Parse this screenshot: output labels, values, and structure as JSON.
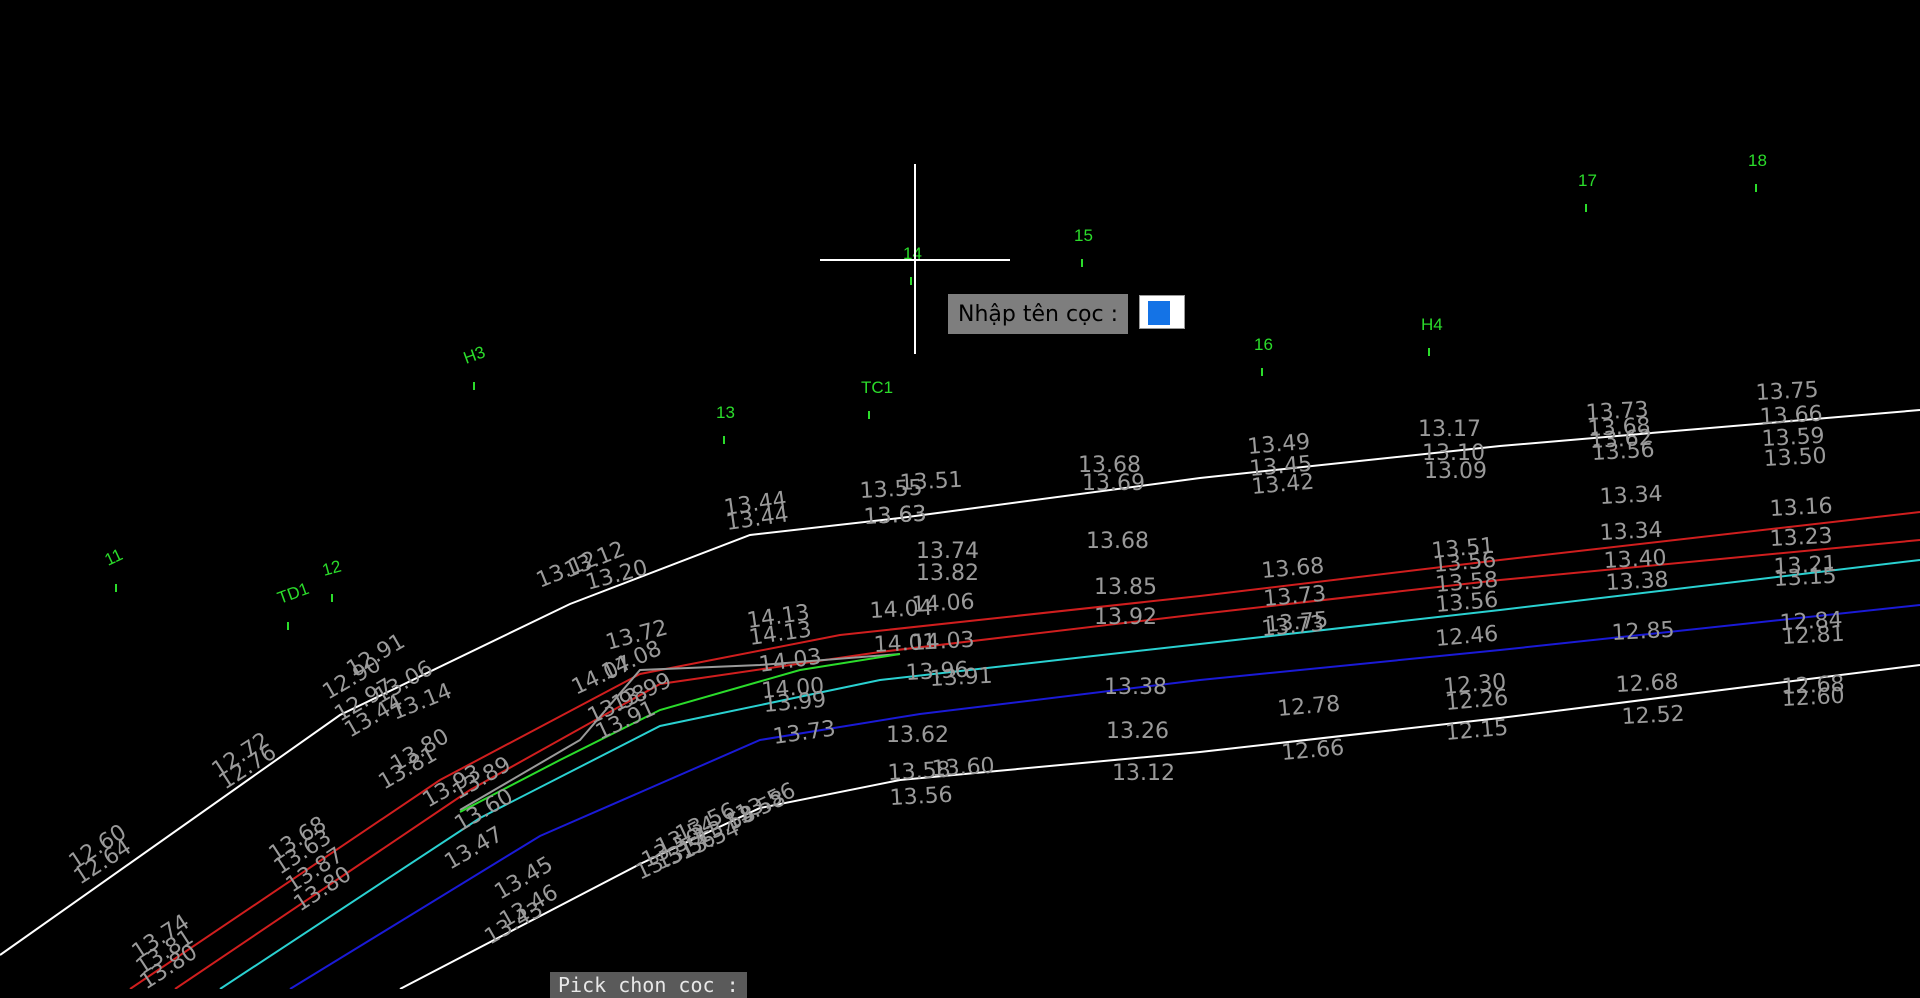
{
  "prompt": {
    "label": "Nhập tên cọc :",
    "input_value": ""
  },
  "status": {
    "command_text": "Pick chon coc :"
  },
  "colors": {
    "background": "#000000",
    "road_edge": "#ffffff",
    "red_line": "#d01e1e",
    "green_line": "#2bdc2b",
    "cyan_line": "#2ad1d1",
    "blue_line": "#1a1ad6",
    "text_gray": "#9a9a9a",
    "stake_label": "#2bdc2b"
  },
  "icons": {
    "cursor": "crosshair-icon",
    "text_caret": "input-caret-icon"
  },
  "stakes": [
    {
      "label": "11"
    },
    {
      "label": "TD1"
    },
    {
      "label": "12"
    },
    {
      "label": "H3"
    },
    {
      "label": "13"
    },
    {
      "label": "TC1"
    },
    {
      "label": "14"
    },
    {
      "label": "15"
    },
    {
      "label": "16"
    },
    {
      "label": "H4"
    },
    {
      "label": "17"
    },
    {
      "label": "18"
    }
  ],
  "elevations": [
    "12.60",
    "12.64",
    "12.72",
    "12.76",
    "12.90",
    "12.91",
    "12.97",
    "13.06",
    "13.14",
    "13.44",
    "13.12",
    "13.12",
    "13.20",
    "13.72",
    "14.07",
    "14.08",
    "13.99",
    "13.98",
    "13.91",
    "14.13",
    "14.13",
    "14.03",
    "14.00",
    "13.99",
    "13.73",
    "13.44",
    "13.44",
    "13.55",
    "13.51",
    "13.63",
    "13.63",
    "13.74",
    "13.82",
    "14.04",
    "14.06",
    "14.01",
    "14.03",
    "13.96",
    "13.91",
    "13.62",
    "13.58",
    "13.56",
    "13.60",
    "13.54",
    "13.58",
    "13.56",
    "13.68",
    "13.69",
    "13.68",
    "13.85",
    "13.92",
    "13.38",
    "13.26",
    "13.12",
    "13.49",
    "13.45",
    "13.42",
    "13.68",
    "13.73",
    "13.75",
    "13.73",
    "12.78",
    "12.66",
    "13.17",
    "13.10",
    "13.09",
    "13.51",
    "13.56",
    "13.58",
    "13.56",
    "12.46",
    "12.30",
    "12.26",
    "12.15",
    "13.73",
    "13.68",
    "13.62",
    "13.56",
    "13.34",
    "13.34",
    "13.40",
    "13.38",
    "12.85",
    "12.68",
    "12.52",
    "13.75",
    "13.66",
    "13.59",
    "13.50",
    "13.16",
    "13.23",
    "13.21",
    "13.15",
    "12.84",
    "12.81",
    "12.68",
    "12.60",
    "13.81",
    "13.80",
    "13.93",
    "13.89",
    "13.60",
    "13.47",
    "13.68",
    "13.63",
    "13.87",
    "13.80",
    "13.74",
    "13.81",
    "13.80",
    "13.45",
    "13.46",
    "13.43",
    "13.58",
    "13.56",
    "13.54",
    "13.51",
    "13.50",
    "13.56"
  ]
}
